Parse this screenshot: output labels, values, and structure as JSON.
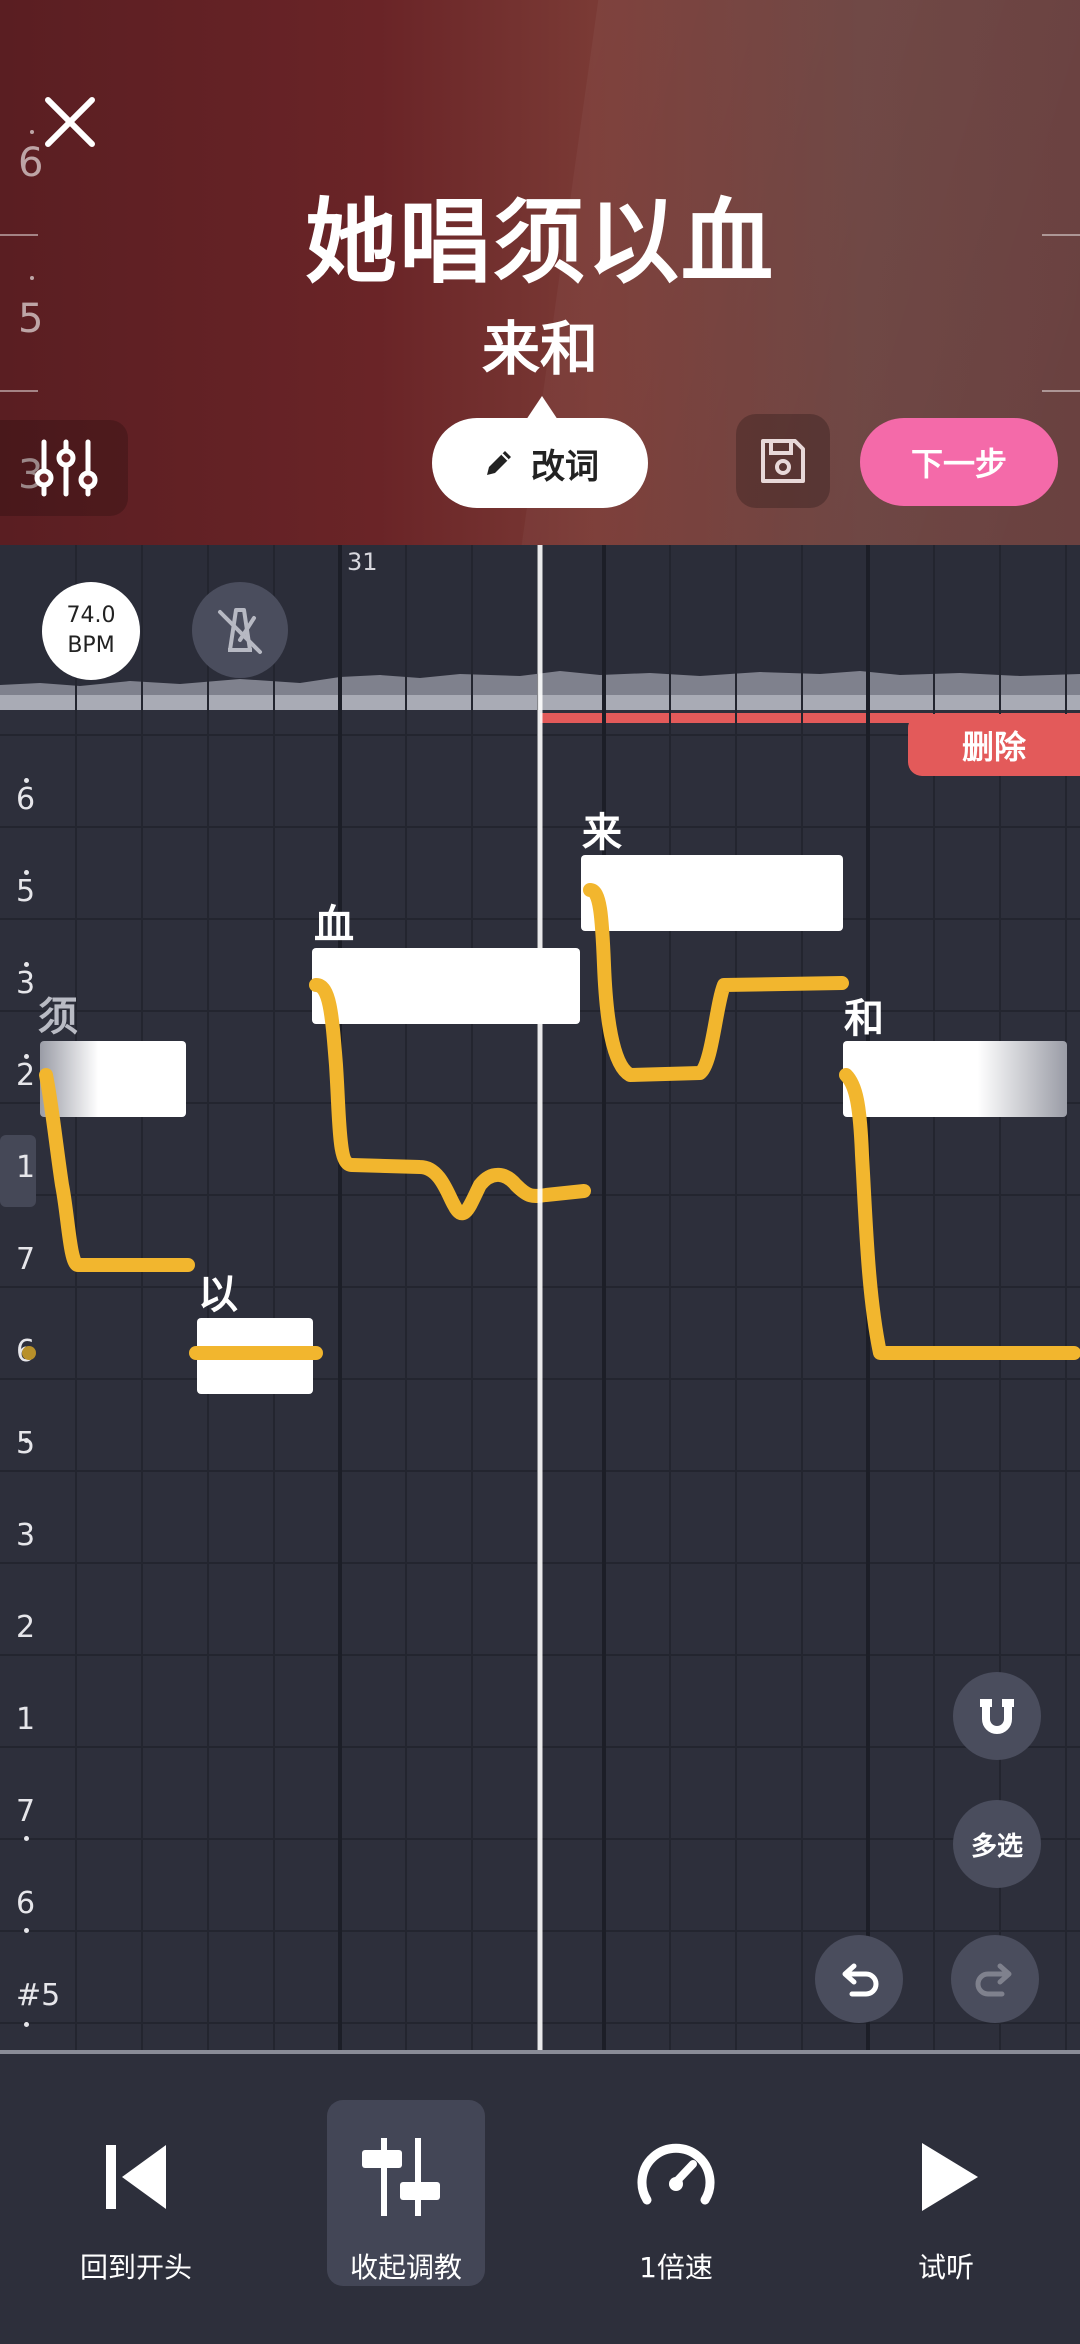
{
  "header": {
    "title": "她唱须以血",
    "subtitle": "来和",
    "edit_lyrics_label": "改词",
    "next_label": "下一步",
    "scale_numbers": [
      "6",
      "5",
      "3"
    ]
  },
  "editor": {
    "bpm_value": "74.0",
    "bpm_unit": "BPM",
    "ruler_marker": "31",
    "delete_label": "删除",
    "scale_labels": [
      "6",
      "5",
      "3",
      "2",
      "1",
      "7",
      "6",
      "5",
      "3",
      "2",
      "1",
      "7",
      "6",
      "#5"
    ],
    "notes": [
      {
        "label": "须"
      },
      {
        "label": "以"
      },
      {
        "label": "血"
      },
      {
        "label": "来"
      },
      {
        "label": "和"
      }
    ],
    "multi_select_label": "多选"
  },
  "toolbar": {
    "back_to_start": "回到开头",
    "collapse_tuning": "收起调教",
    "speed": "1倍速",
    "preview": "试听"
  },
  "colors": {
    "accent_pink": "#f46aa9",
    "pitch_curve": "#f2b62e",
    "delete_red": "#e35a5a",
    "editor_bg": "#2d2f3b"
  }
}
